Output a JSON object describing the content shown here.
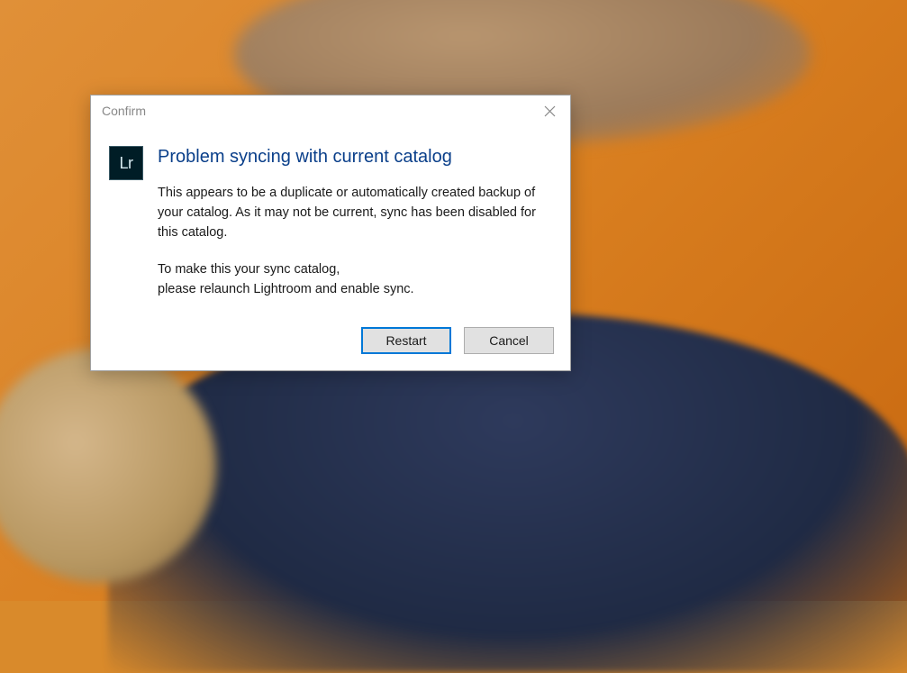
{
  "dialog": {
    "title": "Confirm",
    "heading": "Problem syncing with current catalog",
    "paragraph1": "This appears to be a duplicate or automatically created backup of your catalog.  As it may not be current, sync has been disabled for this catalog.",
    "paragraph2_line1": "To make this your sync catalog,",
    "paragraph2_line2": "please relaunch Lightroom and enable sync.",
    "icon_label": "Lr",
    "buttons": {
      "primary": "Restart",
      "secondary": "Cancel"
    }
  }
}
